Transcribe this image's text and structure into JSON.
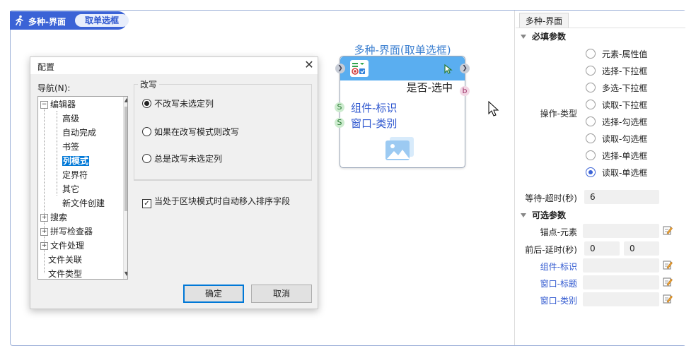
{
  "flow": {
    "title": "多种-界面",
    "pill": "取单选框"
  },
  "dialog": {
    "title": "配置",
    "nav_label": "导航(N):",
    "tree": [
      {
        "label": "编辑器",
        "toggle": "−"
      },
      {
        "label": "高级"
      },
      {
        "label": "自动完成"
      },
      {
        "label": "书签"
      },
      {
        "label": "列模式",
        "selected": true
      },
      {
        "label": "定界符"
      },
      {
        "label": "其它"
      },
      {
        "label": "新文件创建"
      },
      {
        "label": "搜索",
        "toggle": "+"
      },
      {
        "label": "拼写检查器",
        "toggle": "+"
      },
      {
        "label": "文件处理",
        "toggle": "+"
      },
      {
        "label": "文件关联"
      },
      {
        "label": "文件类型"
      }
    ],
    "group_title": "改写",
    "radios": [
      {
        "label": "不改写未选定列",
        "checked": true
      },
      {
        "label": "如果在改写模式则改写",
        "checked": false
      },
      {
        "label": "总是改写未选定列",
        "checked": false
      }
    ],
    "checkbox": {
      "label": "当处于区块模式时自动移入排序字段",
      "checked": true
    },
    "ok_label": "确定",
    "cancel_label": "取消"
  },
  "activity": {
    "title": "多种-界面(取单选框)",
    "output": "是否-选中",
    "output_type": "b",
    "inputs": [
      {
        "type": "S",
        "label": "组件-标识"
      },
      {
        "type": "S",
        "label": "窗口-类别"
      }
    ]
  },
  "panel": {
    "tab": "多种-界面",
    "required_title": "必填参数",
    "op_label": "操作-类型",
    "options": [
      {
        "label": "元素-属性值",
        "checked": false
      },
      {
        "label": "选择-下拉框",
        "checked": false
      },
      {
        "label": "多选-下拉框",
        "checked": false
      },
      {
        "label": "读取-下拉框",
        "checked": false
      },
      {
        "label": "选择-勾选框",
        "checked": false
      },
      {
        "label": "读取-勾选框",
        "checked": false
      },
      {
        "label": "选择-单选框",
        "checked": false
      },
      {
        "label": "读取-单选框",
        "checked": true
      }
    ],
    "timeout_label": "等待-超时(秒)",
    "timeout_value": "6",
    "optional_title": "可选参数",
    "anchor_label": "锚点-元素",
    "delay_label": "前后-延时(秒)",
    "delay_before": "0",
    "delay_after": "0",
    "component_label": "组件-标识",
    "window_title_label": "窗口-标题",
    "window_class_label": "窗口-类别"
  },
  "colors": {
    "accent": "#3b63d6",
    "card_header": "#5aaef0",
    "link": "#2d56cf"
  }
}
